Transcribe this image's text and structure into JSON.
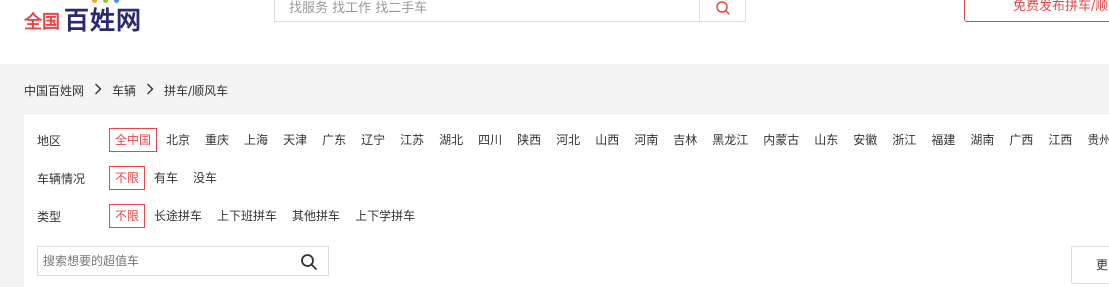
{
  "header": {
    "logo": {
      "region": "全国",
      "brand": "百姓网"
    },
    "search": {
      "placeholder": "找服务 找工作 找二手车"
    },
    "publish_button": "免费发布拼车/顺风车"
  },
  "breadcrumb": [
    "中国百姓网",
    "车辆",
    "拼车/顺风车"
  ],
  "filters": {
    "region": {
      "label": "地区",
      "options": [
        "全中国",
        "北京",
        "重庆",
        "上海",
        "天津",
        "广东",
        "辽宁",
        "江苏",
        "湖北",
        "四川",
        "陕西",
        "河北",
        "山西",
        "河南",
        "吉林",
        "黑龙江",
        "内蒙古",
        "山东",
        "安徽",
        "浙江",
        "福建",
        "湖南",
        "广西",
        "江西",
        "贵州"
      ],
      "selected": "全中国"
    },
    "vehicle": {
      "label": "车辆情况",
      "options": [
        "不限",
        "有车",
        "没车"
      ],
      "selected": "不限"
    },
    "type": {
      "label": "类型",
      "options": [
        "不限",
        "长途拼车",
        "上下班拼车",
        "其他拼车",
        "上下学拼车"
      ],
      "selected": "不限"
    }
  },
  "sub_search": {
    "placeholder": "搜索想要的超值车"
  },
  "more_button": "更多",
  "colors": {
    "accent": "#e84747",
    "brand": "#2a2a72"
  }
}
